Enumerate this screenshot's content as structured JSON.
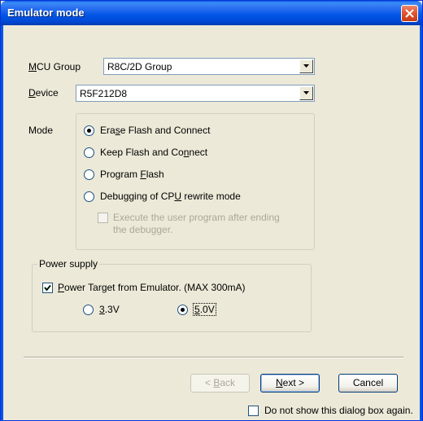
{
  "window": {
    "title": "Emulator mode"
  },
  "mcu_group": {
    "label_key": "M",
    "label_rest": "CU Group",
    "value": "R8C/2D Group"
  },
  "device": {
    "label_key": "D",
    "label_rest": "evice",
    "value": "R5F212D8"
  },
  "mode": {
    "label": "Mode",
    "options": [
      {
        "pre": "Era",
        "key": "s",
        "post": "e Flash and Connect",
        "selected": true
      },
      {
        "pre": "Keep Flash and Co",
        "key": "n",
        "post": "nect",
        "selected": false
      },
      {
        "pre": "Program ",
        "key": "F",
        "post": "lash",
        "selected": false
      },
      {
        "pre": "Debugging of CP",
        "key": "U",
        "post": " rewrite mode",
        "selected": false
      }
    ],
    "sub_option": {
      "line1": "Execute the user program after ending",
      "line2": "the debugger."
    }
  },
  "power_supply": {
    "label": "Power supply",
    "target": {
      "key": "P",
      "rest": "ower Target from Emulator. (MAX 300mA)",
      "checked": true
    },
    "v33": {
      "key": "3",
      "rest": ".3V",
      "selected": false
    },
    "v50": {
      "key": "5",
      "rest": ".0V",
      "selected": true
    }
  },
  "buttons": {
    "back": {
      "pre": "< ",
      "key": "B",
      "post": "ack"
    },
    "next": {
      "key": "N",
      "post": "ext >"
    },
    "cancel": "Cancel"
  },
  "footer": {
    "dont_show": "Do not show this dialog box again."
  }
}
